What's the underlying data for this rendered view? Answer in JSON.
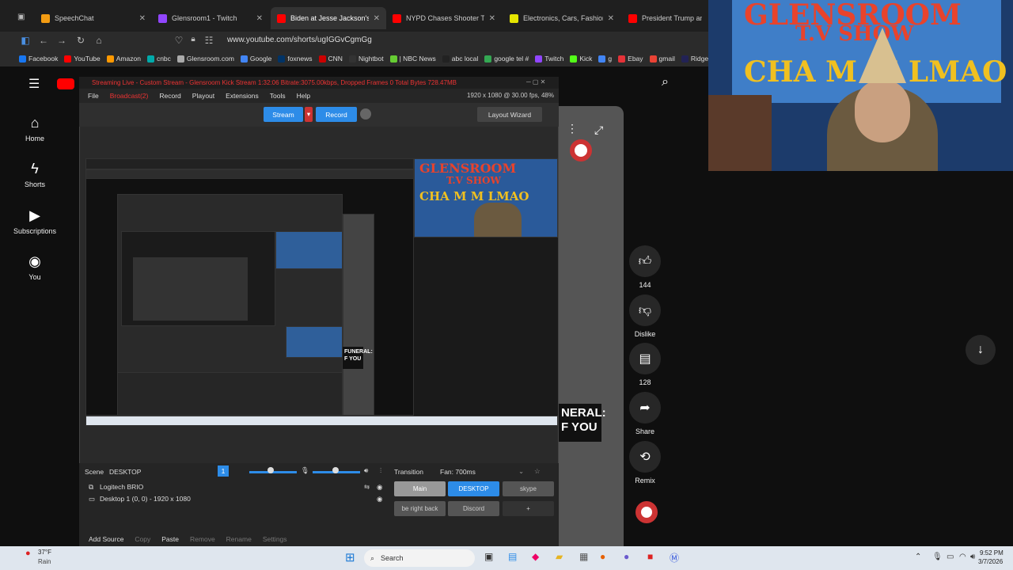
{
  "tabs": [
    {
      "title": "SpeechChat",
      "color": "#f39c12"
    },
    {
      "title": "Glensroom1 - Twitch",
      "color": "#9146ff"
    },
    {
      "title": "Biden at Jesse Jackson's funeral",
      "color": "#ff0000"
    },
    {
      "title": "NYPD Chases Shooter Through",
      "color": "#ff0000"
    },
    {
      "title": "Electronics, Cars, Fashion, Collec",
      "color": "#e5e500"
    },
    {
      "title": "President Trump and The",
      "color": "#ff0000"
    }
  ],
  "address": {
    "url": "www.youtube.com/shorts/ugIGGvCgmGg"
  },
  "bookmarks": [
    {
      "label": "Facebook",
      "color": "#1877f2"
    },
    {
      "label": "YouTube",
      "color": "#ff0000"
    },
    {
      "label": "Amazon",
      "color": "#f90"
    },
    {
      "label": "cnbc",
      "color": "#0aa"
    },
    {
      "label": "Glensroom.com",
      "color": "#aaa"
    },
    {
      "label": "Google",
      "color": "#4285f4"
    },
    {
      "label": "foxnews",
      "color": "#003366"
    },
    {
      "label": "CNN",
      "color": "#cc0000"
    },
    {
      "label": "Nightbot",
      "color": "#333"
    },
    {
      "label": "| NBC News",
      "color": "#6c3"
    },
    {
      "label": "abc local",
      "color": "#222"
    },
    {
      "label": "google tel #",
      "color": "#34a853"
    },
    {
      "label": "Twitch",
      "color": "#9146ff"
    },
    {
      "label": "Kick",
      "color": "#53fc18"
    },
    {
      "label": "g",
      "color": "#4285f4"
    },
    {
      "label": "Ebay",
      "color": "#e53238"
    },
    {
      "label": "gmail",
      "color": "#ea4335"
    },
    {
      "label": "Ridgewood",
      "color": "#225"
    }
  ],
  "yt_nav": [
    {
      "label": "Home",
      "icon": "home-icon"
    },
    {
      "label": "Shorts",
      "icon": "shorts-icon"
    },
    {
      "label": "Subscriptions",
      "icon": "subscriptions-icon"
    },
    {
      "label": "You",
      "icon": "user-icon"
    }
  ],
  "obs": {
    "title": "Streaming Live - Custom Stream - Glensroom Kick Stream 1:32:06 Bitrate:3075.00kbps, Dropped Frames 0 Total Bytes 728.47MB",
    "menu": [
      "File",
      "Broadcast(2)",
      "Record",
      "Playout",
      "Extensions",
      "Tools",
      "Help"
    ],
    "resolution": "1920 x 1080 @ 30.00 fps, 48%",
    "stream_label": "Stream",
    "record_label": "Record",
    "layout_wizard": "Layout Wizard",
    "scene_label": "Scene",
    "scene_value": "DESKTOP",
    "scene_number": "1",
    "transition_label": "Transition",
    "transition_value": "Fan: 700ms",
    "sources": [
      "Logitech BRIO",
      "Desktop 1 (0, 0) - 1920 x 1080"
    ],
    "scene_buttons": [
      "Main",
      "DESKTOP",
      "skype",
      "be right back",
      "Discord",
      "+"
    ],
    "bottom_actions": [
      "Add Source",
      "Copy",
      "Paste",
      "Remove",
      "Rename",
      "Settings"
    ]
  },
  "nested_text": {
    "funeral": "FUNERAL:",
    "ofyou": "F YOU",
    "small_funeral": "NERAL:",
    "small_ofyou": "F YOU"
  },
  "actions": [
    {
      "label": "144",
      "icon": "like-icon"
    },
    {
      "label": "Dislike",
      "icon": "dislike-icon"
    },
    {
      "label": "128",
      "icon": "comment-icon"
    },
    {
      "label": "Share",
      "icon": "share-icon"
    },
    {
      "label": "Remix",
      "icon": "remix-icon"
    }
  ],
  "webcam": {
    "line1": "GLENSROOM",
    "line2": "T.V SHOW",
    "line3": "CHA M M LMAO"
  },
  "taskbar": {
    "weather_temp": "37°F",
    "weather_desc": "Rain",
    "search": "Search",
    "time": "9:52 PM",
    "date": "3/7/2026"
  }
}
